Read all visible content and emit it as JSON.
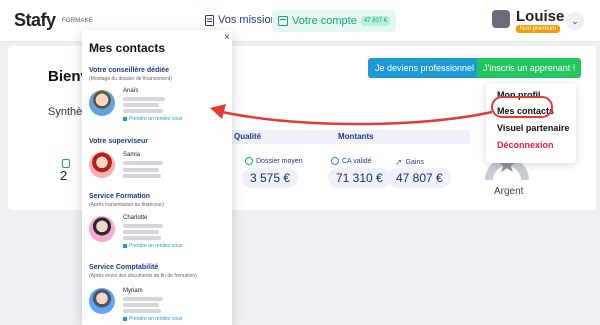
{
  "topbar": {
    "logo": "Stafy",
    "logo_sub": "FORMAKE",
    "nav_missions": "Vos missions",
    "nav_compte": "Votre compte",
    "compte_badge": "47 807 €",
    "user_name": "Louise",
    "user_role": "Non premium"
  },
  "main": {
    "welcome": "Bienv",
    "synthese": "Synthès",
    "btn_pro": "Je deviens professionnel",
    "btn_apprenant": "J'inscris un apprenant !",
    "col_qualite": "Qualité",
    "col_montants": "Montants",
    "stat_dossier_label": "Dossier moyen",
    "stat_dossier_value": "3 575 €",
    "stat_ca_label": "CA validé",
    "stat_ca_value": "71 310 €",
    "stat_gains_label": "Gains",
    "stat_gains_value": "47 807 €",
    "level_label": "Argent",
    "left_stub_digit": "2"
  },
  "user_menu": {
    "items": [
      "Mon profil",
      "Mes contacts",
      "Visuel partenaire",
      "Déconnexion"
    ]
  },
  "contacts": {
    "title": "Mes contacts",
    "close": "×",
    "sections": [
      {
        "title": "Votre conseillère dédiée",
        "subtitle": "(Montage du dossier de financement)",
        "name": "Anaïs",
        "action": "Prendre un rendez vous"
      },
      {
        "title": "Votre superviseur",
        "subtitle": "",
        "name": "Samia",
        "action": ""
      },
      {
        "title": "Service Formation",
        "subtitle": "(Après transmission au financeur)",
        "name": "Charlotte",
        "action": "Prendre un rendez vous"
      },
      {
        "title": "Service Comptabilité",
        "subtitle": "(Après envoi des documents de fin de formation)",
        "name": "Myriam",
        "action": "Prendre un rendez vous"
      }
    ]
  },
  "colors": {
    "accent_blue": "#1e9bd6",
    "accent_green": "#22c55e",
    "alert_red": "#e53935"
  }
}
